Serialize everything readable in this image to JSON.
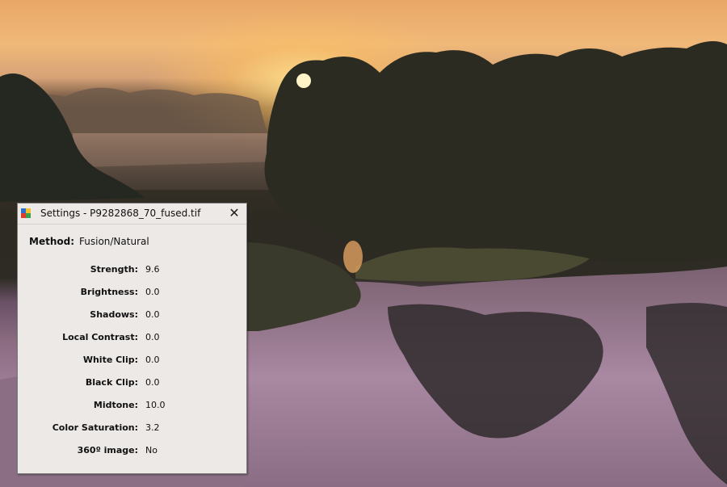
{
  "dialog": {
    "title": "Settings - P9282868_70_fused.tif",
    "close_icon": "close-icon",
    "app_icon": "app-icon",
    "method": {
      "label": "Method:",
      "value": "Fusion/Natural"
    },
    "settings": [
      {
        "label": "Strength:",
        "value": "9.6"
      },
      {
        "label": "Brightness:",
        "value": "0.0"
      },
      {
        "label": "Shadows:",
        "value": "0.0"
      },
      {
        "label": "Local Contrast:",
        "value": "0.0"
      },
      {
        "label": "White Clip:",
        "value": "0.0"
      },
      {
        "label": "Black Clip:",
        "value": "0.0"
      },
      {
        "label": "Midtone:",
        "value": "10.0"
      },
      {
        "label": "Color Saturation:",
        "value": "3.2"
      },
      {
        "label": "360º image:",
        "value": "No"
      }
    ]
  },
  "colors": {
    "dialog_bg": "#ece9e7",
    "sky_glow": "#f0b979",
    "water": "#9d7c95"
  }
}
